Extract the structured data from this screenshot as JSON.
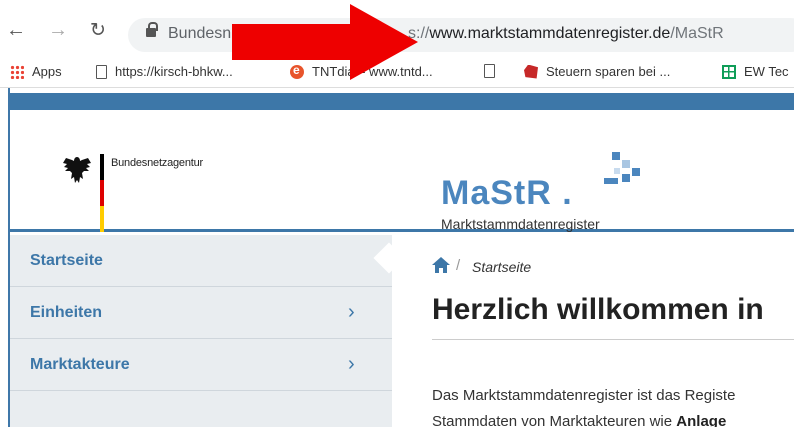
{
  "browser": {
    "site_name": "Bundesn",
    "url_prefix": "s://",
    "url_host": "www.marktstammdatenregister.de",
    "url_path": "/MaStR"
  },
  "bookmarks": [
    {
      "label": "Apps",
      "icon": "apps-icon"
    },
    {
      "label": "https://kirsch-bhkw...",
      "icon": "page-icon"
    },
    {
      "label": "TNTdial - www.tntd...",
      "icon": "tntdial-icon"
    },
    {
      "label": "",
      "icon": "page-icon"
    },
    {
      "label": "Steuern sparen bei ...",
      "icon": "steuern-icon"
    },
    {
      "label": "EW Tec",
      "icon": "sheets-icon"
    }
  ],
  "header": {
    "agency": "Bundesnetzagentur",
    "logo_text": "MaStR",
    "logo_dot": ".",
    "logo_subtitle": "Marktstammdatenregister"
  },
  "sidebar": {
    "items": [
      {
        "label": "Startseite",
        "active": true
      },
      {
        "label": "Einheiten",
        "chevron": "›"
      },
      {
        "label": "Marktakteure",
        "chevron": "›"
      }
    ]
  },
  "main": {
    "breadcrumb_sep": "/",
    "breadcrumb": "Startseite",
    "title": "Herzlich willkommen in",
    "intro_line1": "Das Marktstammdatenregister ist das Registe",
    "intro_line2_start": "Stammdaten von Marktakteuren wie ",
    "intro_line2_bold": "Anlage"
  },
  "colors": {
    "accent": "#3d77a8",
    "annotation": "#ee0000"
  }
}
